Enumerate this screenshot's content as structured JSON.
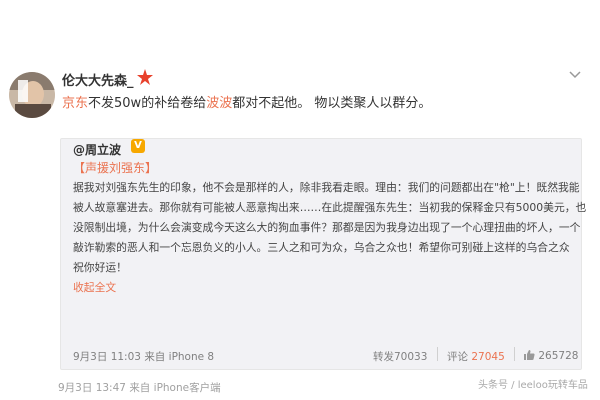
{
  "post": {
    "username": "伦大大先森_",
    "text_link1": "京东",
    "text_mid1": "不发50w的补给卷给",
    "text_link2": "波波",
    "text_rest": "都对不起他。 物以类聚人以群分。"
  },
  "quote": {
    "author": "@周立波",
    "verified_mark": "V",
    "topic": "【声援刘强东】",
    "lines": [
      "据我对刘强东先生的印象，他不会是那样的人，除非我看走眼。理由：我们的问题都出在\"枪\"上！既然我能",
      "被人故意塞进去。那你就有可能被人恶意掏出来……在此提醒强东先生：当初我的保释金只有5000美元，也",
      "没限制出境，为什么会演变成今天这么大的狗血事件？那都是因为我身边出现了一个心理扭曲的坏人，一个",
      "敲诈勒索的恶人和一个忘恩负义的小人。三人之和可为众，乌合之众也！希望你可别碰上这样的乌合之众",
      "祝你好运！"
    ],
    "expand_label": "收起全文",
    "meta_date": "9月3日 11:03",
    "meta_from": "来自",
    "meta_device": "iPhone 8",
    "repost_label": "转发",
    "repost_count": "70033",
    "comment_label": "评论",
    "comment_count": "27045",
    "like_count": "265728"
  },
  "footer": {
    "date": "9月3日 13:47",
    "from": "来自",
    "device": "iPhone客户端"
  },
  "watermark": "头条号 / leeloo玩转车品",
  "colors": {
    "link": "#eb7350",
    "quote_bg": "#f2f2f5",
    "verified": "#f7a800"
  }
}
